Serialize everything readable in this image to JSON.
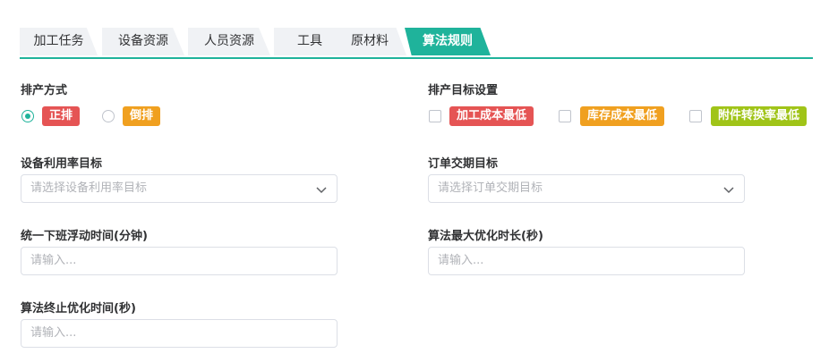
{
  "tabs": [
    {
      "label": "加工任务",
      "active": false
    },
    {
      "label": "设备资源",
      "active": false
    },
    {
      "label": "人员资源",
      "active": false
    },
    {
      "label": "工具",
      "active": false
    },
    {
      "label": "原材料",
      "active": false
    },
    {
      "label": "算法规则",
      "active": true
    }
  ],
  "scheduling_mode": {
    "label": "排产方式",
    "options": [
      {
        "label": "正排",
        "checked": true,
        "color": "#e55454"
      },
      {
        "label": "倒排",
        "checked": false,
        "color": "#f0a020"
      }
    ]
  },
  "goal_settings": {
    "label": "排产目标设置",
    "options": [
      {
        "label": "加工成本最低",
        "checked": false,
        "color": "#e55454"
      },
      {
        "label": "库存成本最低",
        "checked": false,
        "color": "#f0a020"
      },
      {
        "label": "附件转换率最低",
        "checked": false,
        "color": "#a0c418"
      }
    ]
  },
  "fields": {
    "equipment_utilization": {
      "label": "设备利用率目标",
      "placeholder": "请选择设备利用率目标"
    },
    "order_delivery": {
      "label": "订单交期目标",
      "placeholder": "请选择订单交期目标"
    },
    "shift_float": {
      "label": "统一下班浮动时间(分钟)",
      "placeholder": "请输入..."
    },
    "max_optimize": {
      "label": "算法最大优化时长(秒)",
      "placeholder": "请输入..."
    },
    "stop_optimize": {
      "label": "算法终止优化时间(秒)",
      "placeholder": "请输入..."
    }
  },
  "colors": {
    "accent": "#1fb39b"
  }
}
